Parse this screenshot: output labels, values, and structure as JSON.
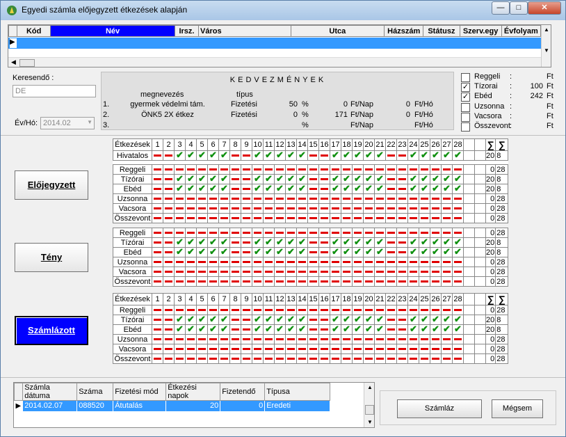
{
  "window": {
    "title": "Egyedi számla előjegyzett étkezések alapján"
  },
  "top_grid": {
    "columns": [
      "Kód",
      "Név",
      "Irsz.",
      "Város",
      "Utca",
      "Házszám",
      "Státusz",
      "Szerv.egy",
      "Évfolyam"
    ]
  },
  "search": {
    "label": "Keresendő :",
    "value": "DE"
  },
  "evho": {
    "label": "Év/Hó:",
    "value": "2014.02"
  },
  "kedv": {
    "title": "KEDVEZMÉNYEK",
    "col_name": "megnevezés",
    "col_type": "típus",
    "rows": [
      {
        "n": "1.",
        "name": "gyermek védelmi tám.",
        "type": "Fizetési",
        "pct": "50",
        "pctsign": "%",
        "nap": "0",
        "napunit": "Ft/Nap",
        "ho": "0",
        "hounit": "Ft/Hó"
      },
      {
        "n": "2.",
        "name": "ÖNK5 2X étkez",
        "type": "Fizetési",
        "pct": "0",
        "pctsign": "%",
        "nap": "171",
        "napunit": "Ft/Nap",
        "ho": "0",
        "hounit": "Ft/Hó"
      },
      {
        "n": "3.",
        "name": "",
        "type": "",
        "pct": "",
        "pctsign": "%",
        "nap": "",
        "napunit": "Ft/Nap",
        "ho": "",
        "hounit": "Ft/Hó"
      }
    ]
  },
  "meals_right": [
    {
      "label": "Reggeli",
      "checked": false,
      "value": "",
      "unit": "Ft"
    },
    {
      "label": "Tízorai",
      "checked": true,
      "value": "100",
      "unit": "Ft"
    },
    {
      "label": "Ebéd",
      "checked": true,
      "value": "242",
      "unit": "Ft"
    },
    {
      "label": "Uzsonna",
      "checked": false,
      "value": "",
      "unit": "Ft"
    },
    {
      "label": "Vacsora",
      "checked": false,
      "value": "",
      "unit": "Ft"
    },
    {
      "label": "Összevont",
      "checked": false,
      "value": "",
      "unit": "Ft"
    }
  ],
  "buttons": {
    "elojegyzett": "Előjegyzett",
    "teny": "Tény",
    "szamlazott": "Számlázott",
    "szamlaz": "Számláz",
    "megsem": "Mégsem"
  },
  "meal_header_label": "Étkezések",
  "hivatalos_label": "Hivatalos",
  "days": [
    "1",
    "2",
    "3",
    "4",
    "5",
    "6",
    "7",
    "8",
    "9",
    "10",
    "11",
    "12",
    "13",
    "14",
    "15",
    "16",
    "17",
    "18",
    "19",
    "20",
    "21",
    "22",
    "23",
    "24",
    "25",
    "26",
    "27",
    "28"
  ],
  "hivatalos": "--VVVVV--VVVVV--VVVVV--VVVVV",
  "hivatalos_tot": [
    "20",
    "8"
  ],
  "rows": [
    {
      "label": "Reggeli",
      "pattern": "----------------------------",
      "tot": [
        "0",
        "28"
      ]
    },
    {
      "label": "Tízórai",
      "pattern": "--VVVVV--VVVVV--VVVVV--VVVVV",
      "tot": [
        "20",
        "8"
      ]
    },
    {
      "label": "Ebéd",
      "pattern": "--VVVVV--VVVVV--VVVVV--VVVVV",
      "tot": [
        "20",
        "8"
      ]
    },
    {
      "label": "Uzsonna",
      "pattern": "----------------------------",
      "tot": [
        "0",
        "28"
      ]
    },
    {
      "label": "Vacsora",
      "pattern": "----------------------------",
      "tot": [
        "0",
        "28"
      ]
    },
    {
      "label": "Összevont",
      "pattern": "----------------------------",
      "tot": [
        "0",
        "28"
      ]
    }
  ],
  "bottom_grid": {
    "columns": [
      "Számla dátuma",
      "Száma",
      "Fizetési mód",
      "Étkezési napok",
      "Fizetendő",
      "Típusa"
    ],
    "row": [
      "2014.02.07",
      "088520",
      "Átutalás",
      "20",
      "0",
      "Eredeti"
    ]
  }
}
